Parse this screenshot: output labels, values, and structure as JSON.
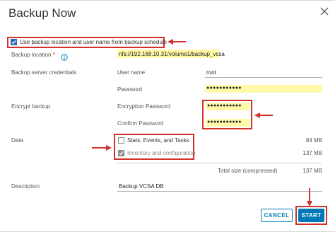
{
  "dialog": {
    "title": "Backup Now",
    "close_icon": "close-icon"
  },
  "schedule_option": {
    "label": "Use backup location and user name from backup schedule",
    "checked": true
  },
  "backup_location": {
    "label": "Backup location",
    "required_mark": "*",
    "info_icon": "info-icon",
    "value": "nfs://192.168.10.31/volume1/backup_vcsa"
  },
  "credentials": {
    "section_label": "Backup server credentials",
    "username_label": "User name",
    "username_value": "root",
    "password_label": "Password",
    "password_value": "●●●●●●●●●●●"
  },
  "encryption": {
    "section_label": "Encrypt backup",
    "encryption_password_label": "Encryption Password",
    "encryption_password_value": "●●●●●●●●●●●",
    "confirm_password_label": "Confirm Password",
    "confirm_password_value": "●●●●●●●●●●●"
  },
  "data": {
    "section_label": "Data",
    "items": [
      {
        "label": "Stats, Events, and Tasks",
        "size": "84 MB",
        "checked": false
      },
      {
        "label": "Inventory and configuration",
        "size": "137 MB",
        "checked": true
      }
    ],
    "total_label": "Total size (compressed)",
    "total_size": "137 MB"
  },
  "description": {
    "label": "Description",
    "value": "Backup VCSA DB"
  },
  "buttons": {
    "cancel": "CANCEL",
    "start": "START"
  },
  "colors": {
    "accent": "#0079b8",
    "annotation_red": "#d0322b",
    "highlight": "#fff9a8"
  }
}
